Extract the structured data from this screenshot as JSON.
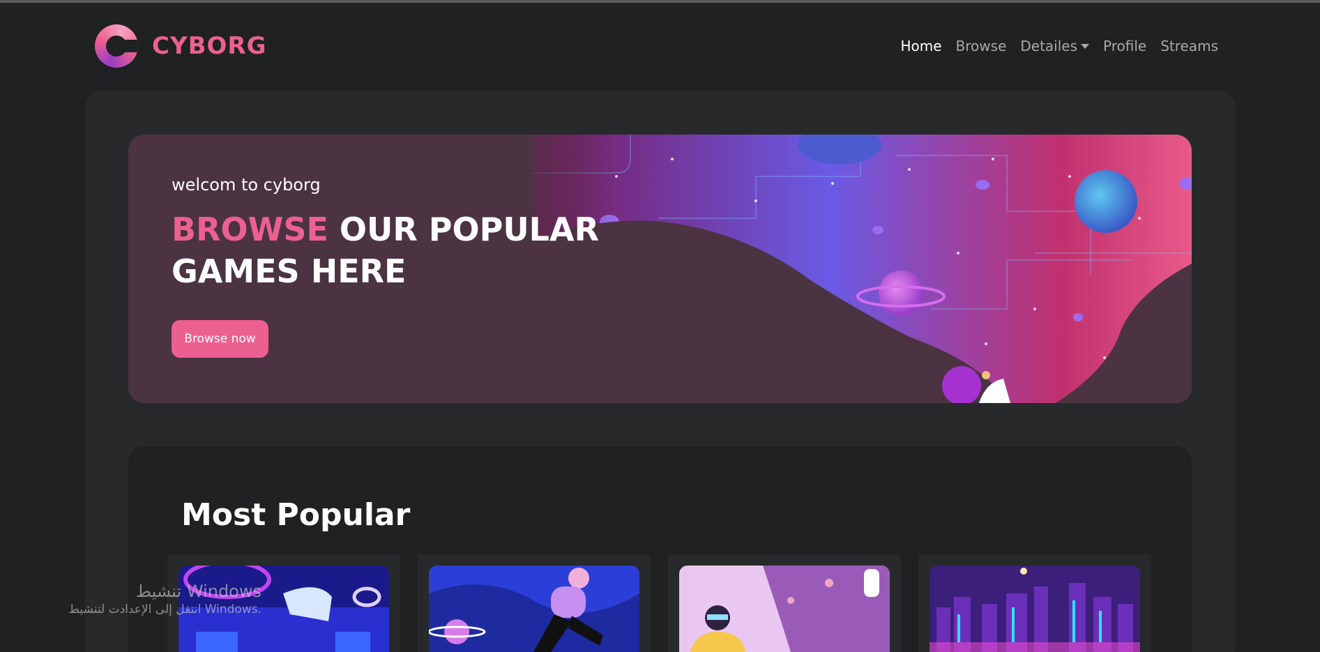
{
  "brand": {
    "name": "CYBORG",
    "accent_color": "#ec6090",
    "logo_icon": "cyborg-logo-icon"
  },
  "nav": {
    "items": [
      {
        "label": "Home",
        "active": true
      },
      {
        "label": "Browse",
        "active": false
      },
      {
        "label": "Detailes",
        "active": false,
        "dropdown": true
      },
      {
        "label": "Profile",
        "active": false
      },
      {
        "label": "Streams",
        "active": false
      }
    ]
  },
  "banner": {
    "welcome": "welcom to cyborg",
    "headline_accent": "BROWSE",
    "headline_line1_rest": " OUR POPULAR",
    "headline_line2": "GAMES HERE",
    "button_label": "Browse now"
  },
  "popular": {
    "title": "Most Popular",
    "cards": [
      {
        "image": "vr-headset-neon-art"
      },
      {
        "image": "vr-player-space-art"
      },
      {
        "image": "vr-girl-astronaut-art"
      },
      {
        "image": "neon-city-skyline-art"
      }
    ]
  },
  "watermark": {
    "title": "تنشيط Windows",
    "subtitle": "انتقل إلى الإعدادت لتنشيط Windows."
  },
  "colors": {
    "background": "#1f2122",
    "panel": "#27292a",
    "accent": "#ec6090",
    "nav_inactive": "#a9a9a9"
  }
}
